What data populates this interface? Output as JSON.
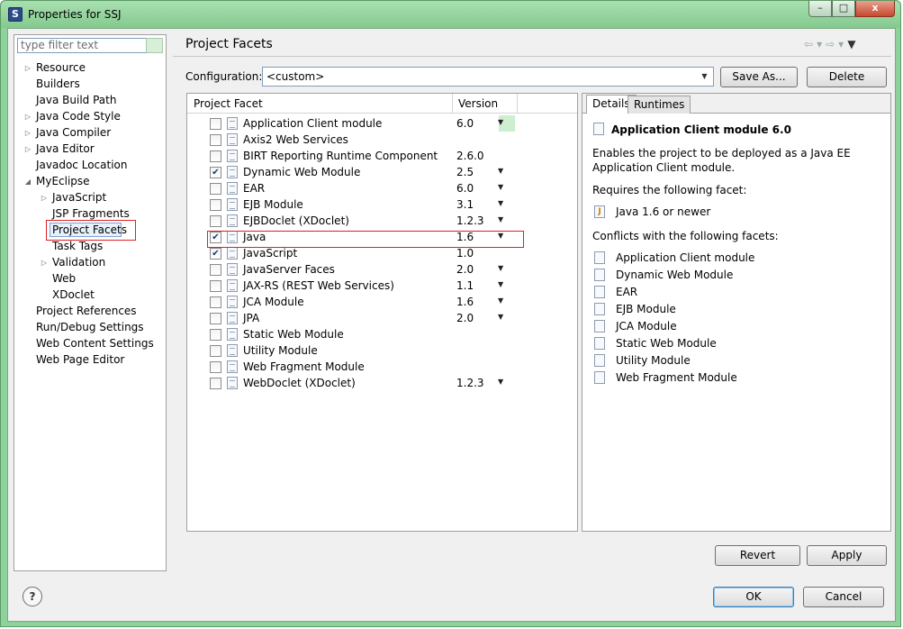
{
  "window": {
    "title": "Properties for SSJ",
    "minimize": "–",
    "maximize": "□",
    "close": "x"
  },
  "filter": {
    "placeholder": "type filter text"
  },
  "tree": [
    {
      "label": "Resource",
      "level": 0,
      "expandable": true
    },
    {
      "label": "Builders",
      "level": 0,
      "expandable": false
    },
    {
      "label": "Java Build Path",
      "level": 0,
      "expandable": false
    },
    {
      "label": "Java Code Style",
      "level": 0,
      "expandable": true
    },
    {
      "label": "Java Compiler",
      "level": 0,
      "expandable": true
    },
    {
      "label": "Java Editor",
      "level": 0,
      "expandable": true
    },
    {
      "label": "Javadoc Location",
      "level": 0,
      "expandable": false
    },
    {
      "label": "MyEclipse",
      "level": 0,
      "expandable": true,
      "expanded": true
    },
    {
      "label": "JavaScript",
      "level": 1,
      "expandable": true
    },
    {
      "label": "JSP Fragments",
      "level": 1,
      "expandable": false
    },
    {
      "label": "Project Facets",
      "level": 1,
      "expandable": false,
      "selected": true
    },
    {
      "label": "Task Tags",
      "level": 1,
      "expandable": false
    },
    {
      "label": "Validation",
      "level": 1,
      "expandable": true
    },
    {
      "label": "Web",
      "level": 1,
      "expandable": false
    },
    {
      "label": "XDoclet",
      "level": 1,
      "expandable": false
    },
    {
      "label": "Project References",
      "level": 0,
      "expandable": false
    },
    {
      "label": "Run/Debug Settings",
      "level": 0,
      "expandable": false
    },
    {
      "label": "Web Content Settings",
      "level": 0,
      "expandable": false
    },
    {
      "label": "Web Page Editor",
      "level": 0,
      "expandable": false
    }
  ],
  "page": {
    "title": "Project Facets"
  },
  "config": {
    "label": "Configuration:",
    "value": "<custom>",
    "save_as": "Save As...",
    "delete": "Delete"
  },
  "facets": {
    "col_facet": "Project Facet",
    "col_version": "Version",
    "rows": [
      {
        "name": "Application Client module",
        "version": "6.0",
        "checked": false,
        "dropdown": true,
        "highlight": true
      },
      {
        "name": "Axis2 Web Services",
        "version": "",
        "checked": false,
        "dropdown": false
      },
      {
        "name": "BIRT Reporting Runtime Component",
        "version": "2.6.0",
        "checked": false,
        "dropdown": false
      },
      {
        "name": "Dynamic Web Module",
        "version": "2.5",
        "checked": true,
        "dropdown": true
      },
      {
        "name": "EAR",
        "version": "6.0",
        "checked": false,
        "dropdown": true
      },
      {
        "name": "EJB Module",
        "version": "3.1",
        "checked": false,
        "dropdown": true
      },
      {
        "name": "EJBDoclet (XDoclet)",
        "version": "1.2.3",
        "checked": false,
        "dropdown": true
      },
      {
        "name": "Java",
        "version": "1.6",
        "checked": true,
        "dropdown": true,
        "java": true
      },
      {
        "name": "JavaScript",
        "version": "1.0",
        "checked": true,
        "dropdown": false
      },
      {
        "name": "JavaServer Faces",
        "version": "2.0",
        "checked": false,
        "dropdown": true
      },
      {
        "name": "JAX-RS (REST Web Services)",
        "version": "1.1",
        "checked": false,
        "dropdown": true
      },
      {
        "name": "JCA Module",
        "version": "1.6",
        "checked": false,
        "dropdown": true
      },
      {
        "name": "JPA",
        "version": "2.0",
        "checked": false,
        "dropdown": true
      },
      {
        "name": "Static Web Module",
        "version": "",
        "checked": false,
        "dropdown": false
      },
      {
        "name": "Utility Module",
        "version": "",
        "checked": false,
        "dropdown": false
      },
      {
        "name": "Web Fragment Module",
        "version": "",
        "checked": false,
        "dropdown": false
      },
      {
        "name": "WebDoclet (XDoclet)",
        "version": "1.2.3",
        "checked": false,
        "dropdown": true
      }
    ]
  },
  "details": {
    "tab_details": "Details",
    "tab_runtimes": "Runtimes",
    "title": "Application Client module 6.0",
    "description_line1": "Enables the project to be deployed as a Java EE",
    "description_line2": "Application Client module.",
    "requires_label": "Requires the following facet:",
    "requires": [
      "Java 1.6 or newer"
    ],
    "conflicts_label": "Conflicts with the following facets:",
    "conflicts": [
      "Application Client module",
      "Dynamic Web Module",
      "EAR",
      "EJB Module",
      "JCA Module",
      "Static Web Module",
      "Utility Module",
      "Web Fragment Module"
    ]
  },
  "buttons": {
    "revert": "Revert",
    "apply": "Apply",
    "ok": "OK",
    "cancel": "Cancel",
    "help": "?"
  },
  "nav": {
    "back": "⇦",
    "forward": "⇨",
    "dropdown": "▾",
    "menu": "▼"
  }
}
